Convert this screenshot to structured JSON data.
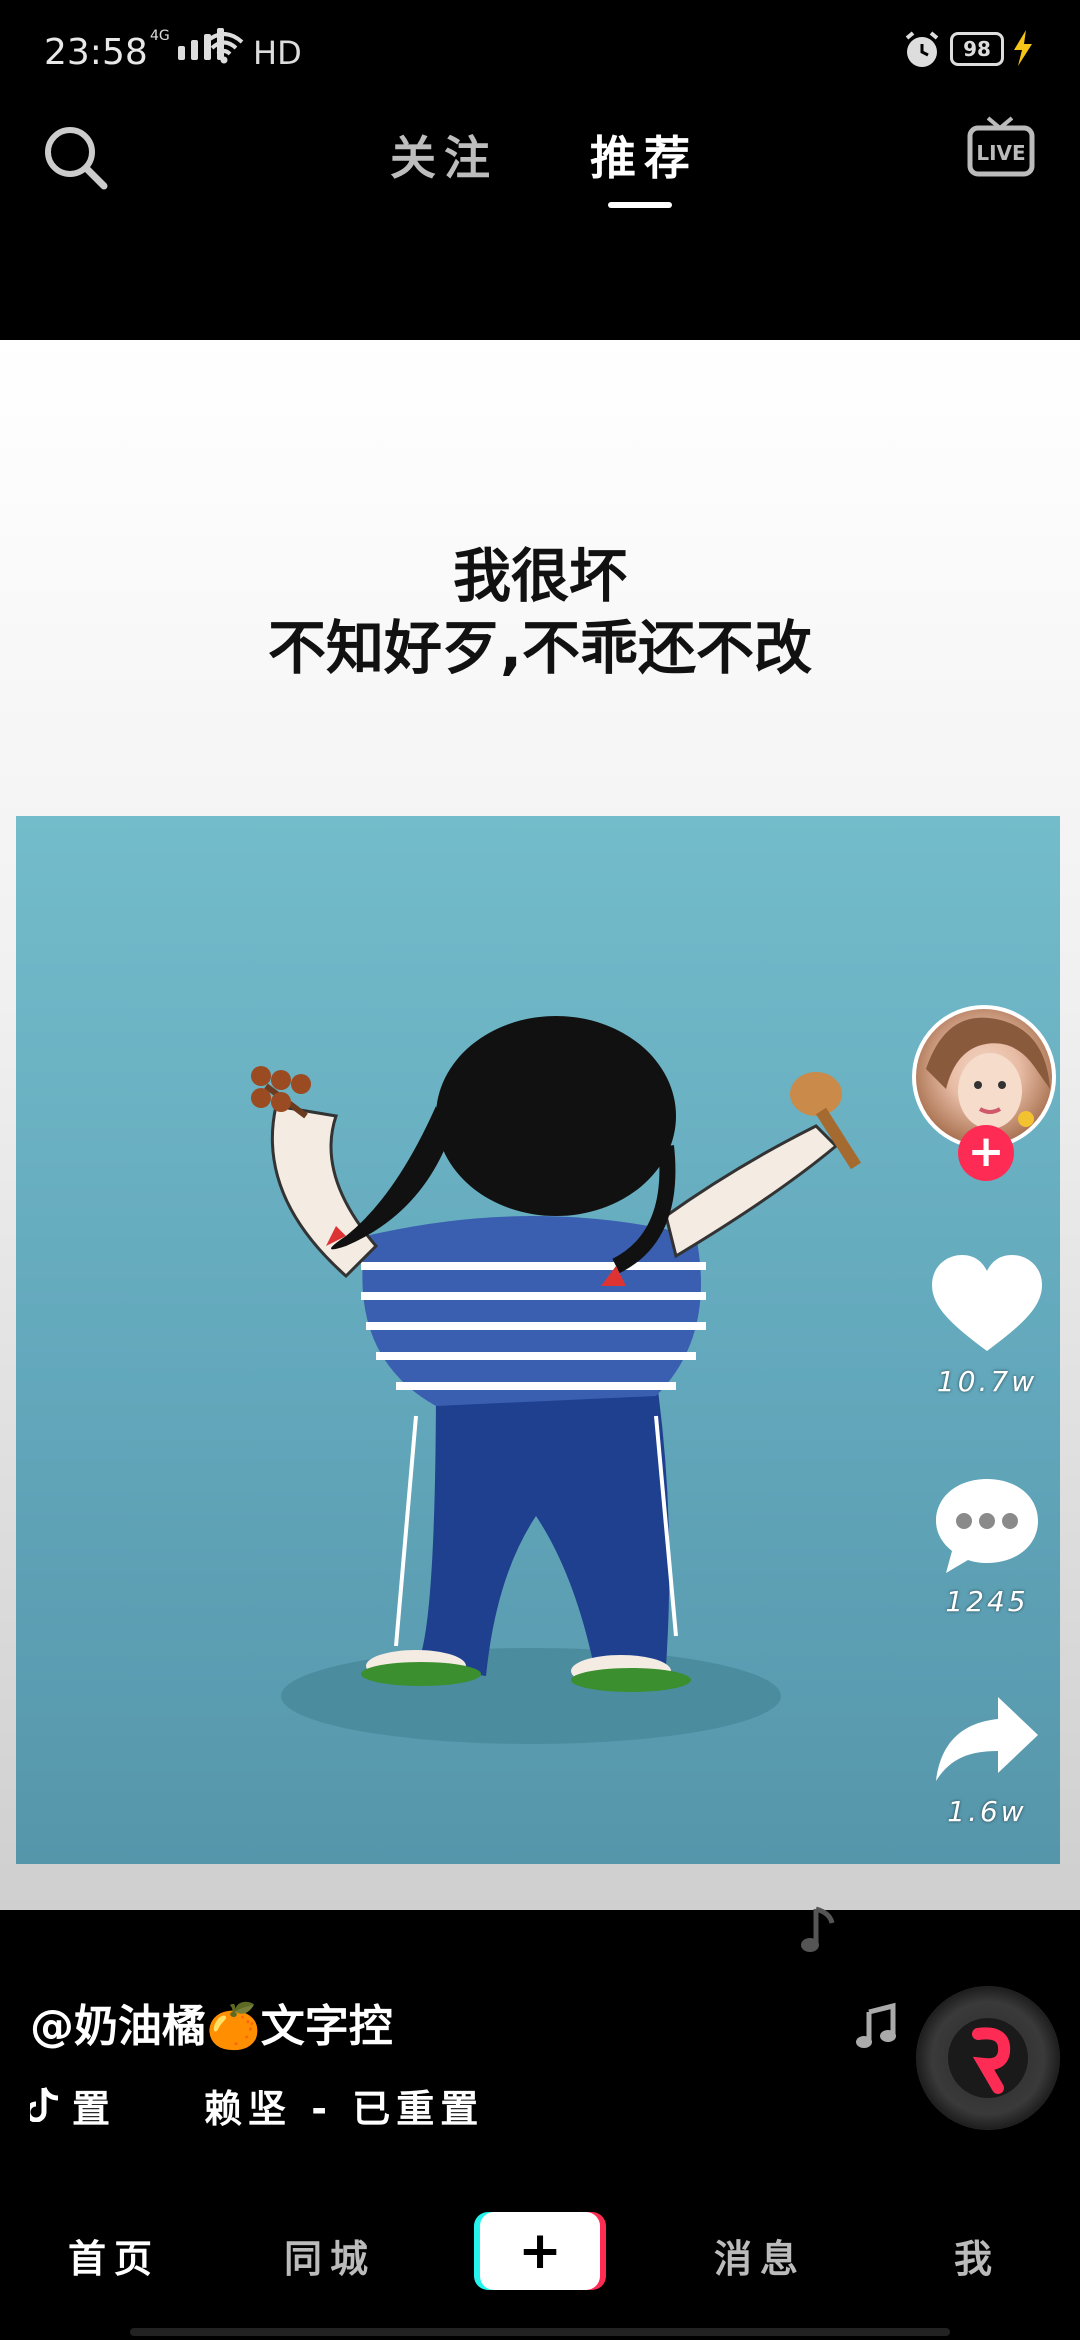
{
  "status_bar": {
    "time": "23:58",
    "network": "4G",
    "hd": "HD",
    "battery": "98"
  },
  "top_nav": {
    "tabs": [
      "关注",
      "推荐"
    ],
    "active_tab": "推荐",
    "live_label": "LIVE"
  },
  "video": {
    "caption_line1": "我很坏",
    "caption_line2": "不知好歹,不乖还不改"
  },
  "actions": {
    "likes": "10.7w",
    "comments": "1245",
    "shares": "1.6w"
  },
  "post": {
    "author": "@奶油橘🍊文字控",
    "song": "置　　赖坚 - 已重置　　"
  },
  "bottom_nav": {
    "home": "首页",
    "city": "同城",
    "messages": "消息",
    "me": "我",
    "create": "+"
  },
  "colors": {
    "accent": "#fe2c55",
    "accent2": "#25f4ee",
    "background": "#000000"
  }
}
